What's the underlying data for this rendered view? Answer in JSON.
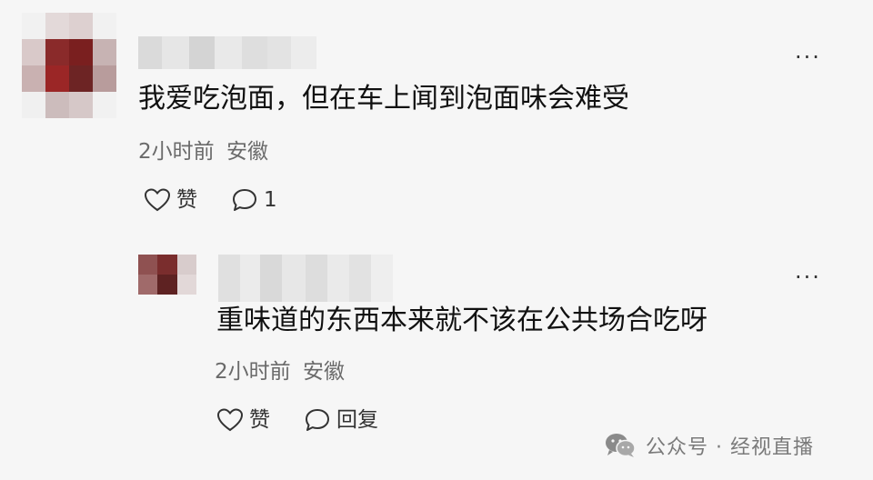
{
  "comment": {
    "text": "我爱吃泡面，但在车上闻到泡面味会难受",
    "time": "2小时前",
    "location": "安徽",
    "like_label": "赞",
    "reply_count": "1",
    "more_label": "..."
  },
  "reply": {
    "text": "重味道的东西本来就不该在公共场合吃呀",
    "time": "2小时前",
    "location": "安徽",
    "like_label": "赞",
    "reply_label": "回复",
    "more_label": "..."
  },
  "watermark": {
    "text": "公众号 · 经视直播"
  },
  "icons": {
    "like": "heart-icon",
    "comment": "speech-bubble-icon",
    "more": "more-dots-icon",
    "watermark": "wechat-icon"
  },
  "colors": {
    "background": "#f6f6f6",
    "text": "#111111",
    "meta": "#6a6a6a"
  }
}
